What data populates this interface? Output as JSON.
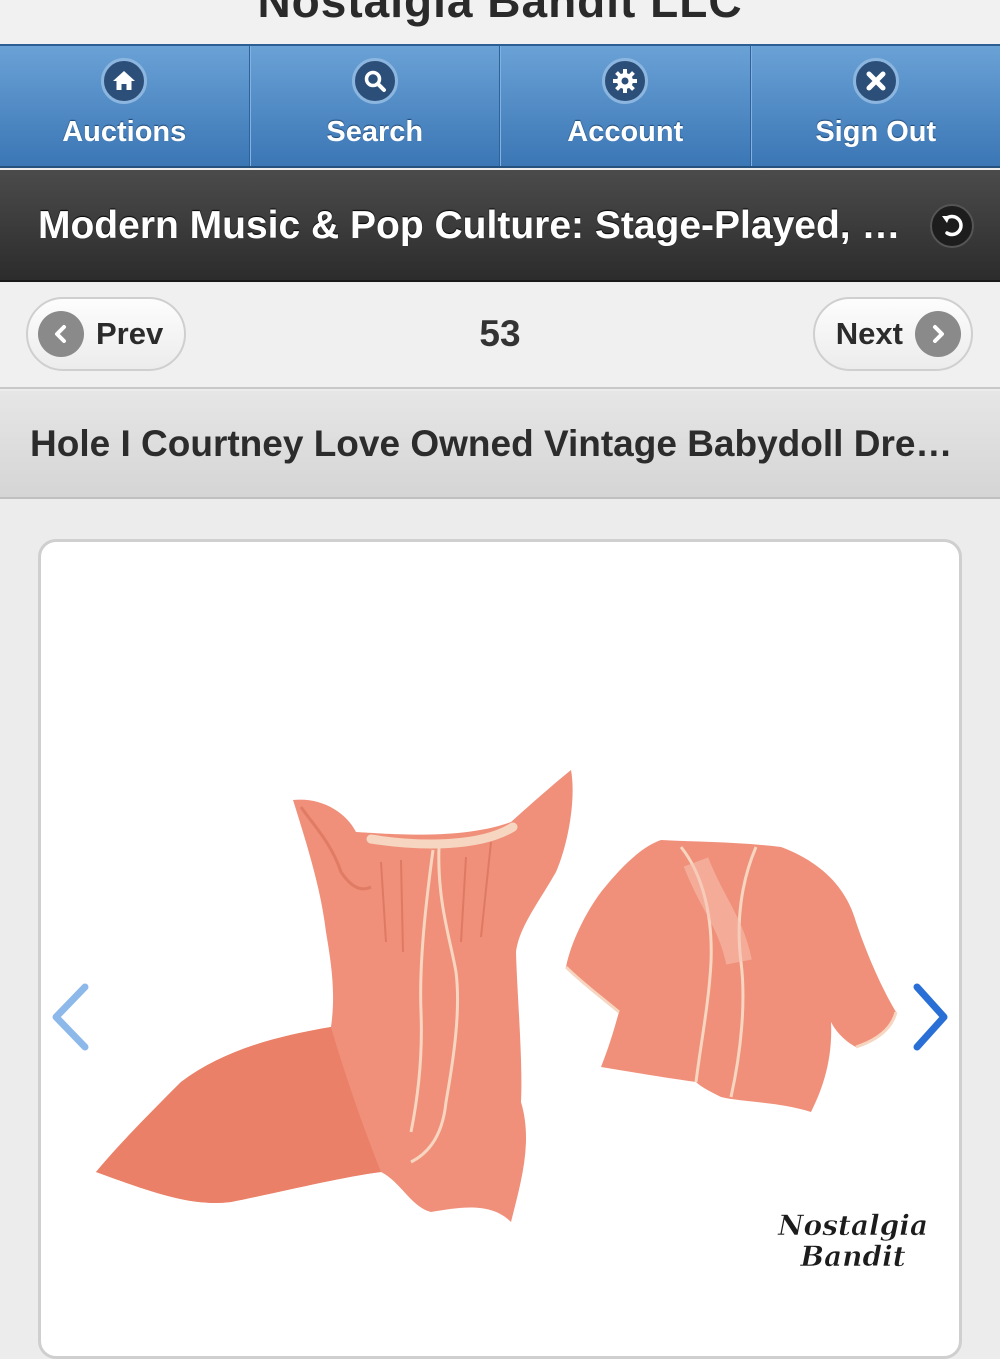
{
  "site": {
    "title": "Nostalgia Bandit LLC"
  },
  "nav": {
    "items": [
      {
        "label": "Auctions",
        "icon": "home-icon"
      },
      {
        "label": "Search",
        "icon": "search-icon"
      },
      {
        "label": "Account",
        "icon": "gear-icon"
      },
      {
        "label": "Sign Out",
        "icon": "close-icon"
      }
    ]
  },
  "category": {
    "title": "Modern Music & Pop Culture: Stage-Played, Stage-Worn & Memorabilia",
    "back_icon": "back-icon"
  },
  "pager": {
    "prev_label": "Prev",
    "next_label": "Next",
    "page_number": "53"
  },
  "item": {
    "title": "Hole I Courtney Love Owned Vintage Babydoll Dress & Bolero Set"
  },
  "gallery": {
    "prev_icon": "chevron-left-icon",
    "next_icon": "chevron-right-icon",
    "watermark_line1": "Nostalgia",
    "watermark_line2": "Bandit",
    "garment_color": "#f0907a",
    "arrow_color": "#2a6fd6"
  }
}
